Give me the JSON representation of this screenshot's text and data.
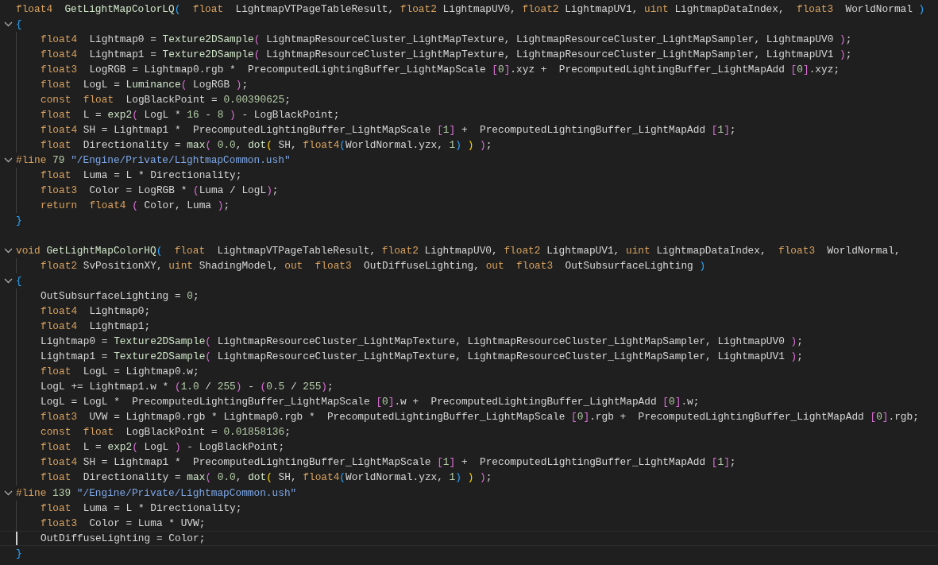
{
  "editor": {
    "lines": [
      {
        "fold": false,
        "indented": false,
        "current": false,
        "segments": [
          {
            "kind": "keyword",
            "text": "float4  "
          },
          {
            "kind": "function",
            "text": "GetLightMapColorLQ"
          },
          {
            "kind": "bracket1",
            "text": "(  "
          },
          {
            "kind": "keyword",
            "text": "float"
          },
          {
            "kind": "plain",
            "text": "  LightmapVTPageTableResult, "
          },
          {
            "kind": "keyword",
            "text": "float2"
          },
          {
            "kind": "plain",
            "text": " LightmapUV0, "
          },
          {
            "kind": "keyword",
            "text": "float2"
          },
          {
            "kind": "plain",
            "text": " LightmapUV1, "
          },
          {
            "kind": "keyword",
            "text": "uint"
          },
          {
            "kind": "plain",
            "text": " LightmapDataIndex,  "
          },
          {
            "kind": "keyword",
            "text": "float3"
          },
          {
            "kind": "plain",
            "text": "  WorldNormal "
          },
          {
            "kind": "bracket1",
            "text": ")"
          }
        ]
      },
      {
        "fold": true,
        "indented": false,
        "current": false,
        "segments": [
          {
            "kind": "bracket1",
            "text": "{"
          }
        ]
      },
      {
        "fold": false,
        "indented": true,
        "current": false,
        "segments": [
          {
            "kind": "keyword",
            "text": "float4"
          },
          {
            "kind": "plain",
            "text": "  Lightmap0 = "
          },
          {
            "kind": "function",
            "text": "Texture2DSample"
          },
          {
            "kind": "bracket2",
            "text": "("
          },
          {
            "kind": "plain",
            "text": " LightmapResourceCluster_LightMapTexture, LightmapResourceCluster_LightMapSampler, LightmapUV0 "
          },
          {
            "kind": "bracket2",
            "text": ")"
          },
          {
            "kind": "plain",
            "text": ";"
          }
        ]
      },
      {
        "fold": false,
        "indented": true,
        "current": false,
        "segments": [
          {
            "kind": "keyword",
            "text": "float4"
          },
          {
            "kind": "plain",
            "text": "  Lightmap1 = "
          },
          {
            "kind": "function",
            "text": "Texture2DSample"
          },
          {
            "kind": "bracket2",
            "text": "("
          },
          {
            "kind": "plain",
            "text": " LightmapResourceCluster_LightMapTexture, LightmapResourceCluster_LightMapSampler, LightmapUV1 "
          },
          {
            "kind": "bracket2",
            "text": ")"
          },
          {
            "kind": "plain",
            "text": ";"
          }
        ]
      },
      {
        "fold": false,
        "indented": true,
        "current": false,
        "segments": [
          {
            "kind": "keyword",
            "text": "float3"
          },
          {
            "kind": "plain",
            "text": "  LogRGB = Lightmap0.rgb *  PrecomputedLightingBuffer_LightMapScale "
          },
          {
            "kind": "bracket2",
            "text": "["
          },
          {
            "kind": "number",
            "text": "0"
          },
          {
            "kind": "bracket2",
            "text": "]"
          },
          {
            "kind": "plain",
            "text": ".xyz +  PrecomputedLightingBuffer_LightMapAdd "
          },
          {
            "kind": "bracket2",
            "text": "["
          },
          {
            "kind": "number",
            "text": "0"
          },
          {
            "kind": "bracket2",
            "text": "]"
          },
          {
            "kind": "plain",
            "text": ".xyz;"
          }
        ]
      },
      {
        "fold": false,
        "indented": true,
        "current": false,
        "segments": [
          {
            "kind": "keyword",
            "text": "float"
          },
          {
            "kind": "plain",
            "text": "  LogL = "
          },
          {
            "kind": "function",
            "text": "Luminance"
          },
          {
            "kind": "bracket2",
            "text": "("
          },
          {
            "kind": "plain",
            "text": " LogRGB "
          },
          {
            "kind": "bracket2",
            "text": ")"
          },
          {
            "kind": "plain",
            "text": ";"
          }
        ]
      },
      {
        "fold": false,
        "indented": true,
        "current": false,
        "segments": [
          {
            "kind": "keyword",
            "text": "const  "
          },
          {
            "kind": "keyword",
            "text": "float"
          },
          {
            "kind": "plain",
            "text": "  LogBlackPoint = "
          },
          {
            "kind": "number",
            "text": "0.00390625"
          },
          {
            "kind": "plain",
            "text": ";"
          }
        ]
      },
      {
        "fold": false,
        "indented": true,
        "current": false,
        "segments": [
          {
            "kind": "keyword",
            "text": "float"
          },
          {
            "kind": "plain",
            "text": "  L = "
          },
          {
            "kind": "function",
            "text": "exp2"
          },
          {
            "kind": "bracket2",
            "text": "("
          },
          {
            "kind": "plain",
            "text": " LogL * "
          },
          {
            "kind": "number",
            "text": "16"
          },
          {
            "kind": "plain",
            "text": " - "
          },
          {
            "kind": "number",
            "text": "8 "
          },
          {
            "kind": "bracket2",
            "text": ")"
          },
          {
            "kind": "plain",
            "text": " - LogBlackPoint;"
          }
        ]
      },
      {
        "fold": false,
        "indented": true,
        "current": false,
        "segments": [
          {
            "kind": "keyword",
            "text": "float4"
          },
          {
            "kind": "plain",
            "text": " SH = Lightmap1 *  PrecomputedLightingBuffer_LightMapScale "
          },
          {
            "kind": "bracket2",
            "text": "["
          },
          {
            "kind": "number",
            "text": "1"
          },
          {
            "kind": "bracket2",
            "text": "]"
          },
          {
            "kind": "plain",
            "text": " +  PrecomputedLightingBuffer_LightMapAdd "
          },
          {
            "kind": "bracket2",
            "text": "["
          },
          {
            "kind": "number",
            "text": "1"
          },
          {
            "kind": "bracket2",
            "text": "]"
          },
          {
            "kind": "plain",
            "text": ";"
          }
        ]
      },
      {
        "fold": false,
        "indented": true,
        "current": false,
        "segments": [
          {
            "kind": "keyword",
            "text": "float"
          },
          {
            "kind": "plain",
            "text": "  Directionality = "
          },
          {
            "kind": "function",
            "text": "max"
          },
          {
            "kind": "bracket2",
            "text": "( "
          },
          {
            "kind": "number",
            "text": "0.0"
          },
          {
            "kind": "plain",
            "text": ", "
          },
          {
            "kind": "function",
            "text": "dot"
          },
          {
            "kind": "bracket3",
            "text": "("
          },
          {
            "kind": "plain",
            "text": " SH, "
          },
          {
            "kind": "keyword",
            "text": "float4"
          },
          {
            "kind": "bracket1",
            "text": "("
          },
          {
            "kind": "plain",
            "text": "WorldNormal.yzx, "
          },
          {
            "kind": "number",
            "text": "1"
          },
          {
            "kind": "bracket1",
            "text": ") "
          },
          {
            "kind": "bracket3",
            "text": ") "
          },
          {
            "kind": "bracket2",
            "text": ")"
          },
          {
            "kind": "plain",
            "text": ";"
          }
        ]
      },
      {
        "fold": true,
        "indented": false,
        "current": false,
        "segments": [
          {
            "kind": "keyword",
            "text": "#line "
          },
          {
            "kind": "number",
            "text": "79 "
          },
          {
            "kind": "string",
            "text": "\"/Engine/Private/LightmapCommon.ush\""
          }
        ]
      },
      {
        "fold": false,
        "indented": true,
        "current": false,
        "segments": [
          {
            "kind": "keyword",
            "text": "float"
          },
          {
            "kind": "plain",
            "text": "  Luma = L * Directionality;"
          }
        ]
      },
      {
        "fold": false,
        "indented": true,
        "current": false,
        "segments": [
          {
            "kind": "keyword",
            "text": "float3"
          },
          {
            "kind": "plain",
            "text": "  Color = LogRGB * "
          },
          {
            "kind": "bracket2",
            "text": "("
          },
          {
            "kind": "plain",
            "text": "Luma / LogL"
          },
          {
            "kind": "bracket2",
            "text": ")"
          },
          {
            "kind": "plain",
            "text": ";"
          }
        ]
      },
      {
        "fold": false,
        "indented": true,
        "current": false,
        "segments": [
          {
            "kind": "keyword",
            "text": "return  "
          },
          {
            "kind": "keyword",
            "text": "float4 "
          },
          {
            "kind": "bracket2",
            "text": "("
          },
          {
            "kind": "plain",
            "text": " Color, Luma "
          },
          {
            "kind": "bracket2",
            "text": ")"
          },
          {
            "kind": "plain",
            "text": ";"
          }
        ]
      },
      {
        "fold": false,
        "indented": false,
        "current": false,
        "segments": [
          {
            "kind": "bracket1",
            "text": "}"
          }
        ]
      },
      {
        "fold": false,
        "indented": false,
        "current": false
      },
      {
        "fold": true,
        "indented": false,
        "current": false,
        "segments": [
          {
            "kind": "keyword",
            "text": "void "
          },
          {
            "kind": "function",
            "text": "GetLightMapColorHQ"
          },
          {
            "kind": "bracket1",
            "text": "(  "
          },
          {
            "kind": "keyword",
            "text": "float"
          },
          {
            "kind": "plain",
            "text": "  LightmapVTPageTableResult, "
          },
          {
            "kind": "keyword",
            "text": "float2"
          },
          {
            "kind": "plain",
            "text": " LightmapUV0, "
          },
          {
            "kind": "keyword",
            "text": "float2"
          },
          {
            "kind": "plain",
            "text": " LightmapUV1, "
          },
          {
            "kind": "keyword",
            "text": "uint"
          },
          {
            "kind": "plain",
            "text": " LightmapDataIndex,  "
          },
          {
            "kind": "keyword",
            "text": "float3"
          },
          {
            "kind": "plain",
            "text": "  WorldNormal,"
          }
        ]
      },
      {
        "fold": false,
        "indented": true,
        "current": false,
        "segments": [
          {
            "kind": "keyword",
            "text": "float2"
          },
          {
            "kind": "plain",
            "text": " SvPositionXY, "
          },
          {
            "kind": "keyword",
            "text": "uint"
          },
          {
            "kind": "plain",
            "text": " ShadingModel, "
          },
          {
            "kind": "keyword",
            "text": "out  "
          },
          {
            "kind": "keyword",
            "text": "float3"
          },
          {
            "kind": "plain",
            "text": "  OutDiffuseLighting, "
          },
          {
            "kind": "keyword",
            "text": "out  "
          },
          {
            "kind": "keyword",
            "text": "float3"
          },
          {
            "kind": "plain",
            "text": "  OutSubsurfaceLighting "
          },
          {
            "kind": "bracket1",
            "text": ")"
          }
        ]
      },
      {
        "fold": true,
        "indented": false,
        "current": false,
        "segments": [
          {
            "kind": "bracket1",
            "text": "{"
          }
        ]
      },
      {
        "fold": false,
        "indented": true,
        "current": false,
        "segments": [
          {
            "kind": "plain",
            "text": "OutSubsurfaceLighting = "
          },
          {
            "kind": "number",
            "text": "0"
          },
          {
            "kind": "plain",
            "text": ";"
          }
        ]
      },
      {
        "fold": false,
        "indented": true,
        "current": false,
        "segments": [
          {
            "kind": "keyword",
            "text": "float4"
          },
          {
            "kind": "plain",
            "text": "  Lightmap0;"
          }
        ]
      },
      {
        "fold": false,
        "indented": true,
        "current": false,
        "segments": [
          {
            "kind": "keyword",
            "text": "float4"
          },
          {
            "kind": "plain",
            "text": "  Lightmap1;"
          }
        ]
      },
      {
        "fold": false,
        "indented": true,
        "current": false,
        "segments": [
          {
            "kind": "plain",
            "text": "Lightmap0 = "
          },
          {
            "kind": "function",
            "text": "Texture2DSample"
          },
          {
            "kind": "bracket2",
            "text": "("
          },
          {
            "kind": "plain",
            "text": " LightmapResourceCluster_LightMapTexture, LightmapResourceCluster_LightMapSampler, LightmapUV0 "
          },
          {
            "kind": "bracket2",
            "text": ")"
          },
          {
            "kind": "plain",
            "text": ";"
          }
        ]
      },
      {
        "fold": false,
        "indented": true,
        "current": false,
        "segments": [
          {
            "kind": "plain",
            "text": "Lightmap1 = "
          },
          {
            "kind": "function",
            "text": "Texture2DSample"
          },
          {
            "kind": "bracket2",
            "text": "("
          },
          {
            "kind": "plain",
            "text": " LightmapResourceCluster_LightMapTexture, LightmapResourceCluster_LightMapSampler, LightmapUV1 "
          },
          {
            "kind": "bracket2",
            "text": ")"
          },
          {
            "kind": "plain",
            "text": ";"
          }
        ]
      },
      {
        "fold": false,
        "indented": true,
        "current": false,
        "segments": [
          {
            "kind": "keyword",
            "text": "float"
          },
          {
            "kind": "plain",
            "text": "  LogL = Lightmap0.w;"
          }
        ]
      },
      {
        "fold": false,
        "indented": true,
        "current": false,
        "segments": [
          {
            "kind": "plain",
            "text": "LogL += Lightmap1.w * "
          },
          {
            "kind": "bracket2",
            "text": "("
          },
          {
            "kind": "number",
            "text": "1.0"
          },
          {
            "kind": "plain",
            "text": " / "
          },
          {
            "kind": "number",
            "text": "255"
          },
          {
            "kind": "bracket2",
            "text": ")"
          },
          {
            "kind": "plain",
            "text": " - "
          },
          {
            "kind": "bracket2",
            "text": "("
          },
          {
            "kind": "number",
            "text": "0.5"
          },
          {
            "kind": "plain",
            "text": " / "
          },
          {
            "kind": "number",
            "text": "255"
          },
          {
            "kind": "bracket2",
            "text": ")"
          },
          {
            "kind": "plain",
            "text": ";"
          }
        ]
      },
      {
        "fold": false,
        "indented": true,
        "current": false,
        "segments": [
          {
            "kind": "plain",
            "text": "LogL = LogL *  PrecomputedLightingBuffer_LightMapScale "
          },
          {
            "kind": "bracket2",
            "text": "["
          },
          {
            "kind": "number",
            "text": "0"
          },
          {
            "kind": "bracket2",
            "text": "]"
          },
          {
            "kind": "plain",
            "text": ".w +  PrecomputedLightingBuffer_LightMapAdd "
          },
          {
            "kind": "bracket2",
            "text": "["
          },
          {
            "kind": "number",
            "text": "0"
          },
          {
            "kind": "bracket2",
            "text": "]"
          },
          {
            "kind": "plain",
            "text": ".w;"
          }
        ]
      },
      {
        "fold": false,
        "indented": true,
        "current": false,
        "segments": [
          {
            "kind": "keyword",
            "text": "float3"
          },
          {
            "kind": "plain",
            "text": "  UVW = Lightmap0.rgb * Lightmap0.rgb *  PrecomputedLightingBuffer_LightMapScale "
          },
          {
            "kind": "bracket2",
            "text": "["
          },
          {
            "kind": "number",
            "text": "0"
          },
          {
            "kind": "bracket2",
            "text": "]"
          },
          {
            "kind": "plain",
            "text": ".rgb +  PrecomputedLightingBuffer_LightMapAdd "
          },
          {
            "kind": "bracket2",
            "text": "["
          },
          {
            "kind": "number",
            "text": "0"
          },
          {
            "kind": "bracket2",
            "text": "]"
          },
          {
            "kind": "plain",
            "text": ".rgb;"
          }
        ]
      },
      {
        "fold": false,
        "indented": true,
        "current": false,
        "segments": [
          {
            "kind": "keyword",
            "text": "const  "
          },
          {
            "kind": "keyword",
            "text": "float"
          },
          {
            "kind": "plain",
            "text": "  LogBlackPoint = "
          },
          {
            "kind": "number",
            "text": "0.01858136"
          },
          {
            "kind": "plain",
            "text": ";"
          }
        ]
      },
      {
        "fold": false,
        "indented": true,
        "current": false,
        "segments": [
          {
            "kind": "keyword",
            "text": "float"
          },
          {
            "kind": "plain",
            "text": "  L = "
          },
          {
            "kind": "function",
            "text": "exp2"
          },
          {
            "kind": "bracket2",
            "text": "("
          },
          {
            "kind": "plain",
            "text": " LogL "
          },
          {
            "kind": "bracket2",
            "text": ")"
          },
          {
            "kind": "plain",
            "text": " - LogBlackPoint;"
          }
        ]
      },
      {
        "fold": false,
        "indented": true,
        "current": false,
        "segments": [
          {
            "kind": "keyword",
            "text": "float4"
          },
          {
            "kind": "plain",
            "text": " SH = Lightmap1 *  PrecomputedLightingBuffer_LightMapScale "
          },
          {
            "kind": "bracket2",
            "text": "["
          },
          {
            "kind": "number",
            "text": "1"
          },
          {
            "kind": "bracket2",
            "text": "]"
          },
          {
            "kind": "plain",
            "text": " +  PrecomputedLightingBuffer_LightMapAdd "
          },
          {
            "kind": "bracket2",
            "text": "["
          },
          {
            "kind": "number",
            "text": "1"
          },
          {
            "kind": "bracket2",
            "text": "]"
          },
          {
            "kind": "plain",
            "text": ";"
          }
        ]
      },
      {
        "fold": false,
        "indented": true,
        "current": false,
        "segments": [
          {
            "kind": "keyword",
            "text": "float"
          },
          {
            "kind": "plain",
            "text": "  Directionality = "
          },
          {
            "kind": "function",
            "text": "max"
          },
          {
            "kind": "bracket2",
            "text": "( "
          },
          {
            "kind": "number",
            "text": "0.0"
          },
          {
            "kind": "plain",
            "text": ", "
          },
          {
            "kind": "function",
            "text": "dot"
          },
          {
            "kind": "bracket3",
            "text": "("
          },
          {
            "kind": "plain",
            "text": " SH, "
          },
          {
            "kind": "keyword",
            "text": "float4"
          },
          {
            "kind": "bracket1",
            "text": "("
          },
          {
            "kind": "plain",
            "text": "WorldNormal.yzx, "
          },
          {
            "kind": "number",
            "text": "1"
          },
          {
            "kind": "bracket1",
            "text": ") "
          },
          {
            "kind": "bracket3",
            "text": ") "
          },
          {
            "kind": "bracket2",
            "text": ")"
          },
          {
            "kind": "plain",
            "text": ";"
          }
        ]
      },
      {
        "fold": true,
        "indented": false,
        "current": false,
        "segments": [
          {
            "kind": "keyword",
            "text": "#line "
          },
          {
            "kind": "number",
            "text": "139 "
          },
          {
            "kind": "string",
            "text": "\"/Engine/Private/LightmapCommon.ush\""
          }
        ]
      },
      {
        "fold": false,
        "indented": true,
        "current": false,
        "segments": [
          {
            "kind": "keyword",
            "text": "float"
          },
          {
            "kind": "plain",
            "text": "  Luma = L * Directionality;"
          }
        ]
      },
      {
        "fold": false,
        "indented": true,
        "current": false,
        "segments": [
          {
            "kind": "keyword",
            "text": "float3"
          },
          {
            "kind": "plain",
            "text": "  Color = Luma * UVW;"
          }
        ]
      },
      {
        "fold": false,
        "indented": true,
        "current": true,
        "segments": [
          {
            "kind": "plain",
            "text": "OutDiffuseLighting = Color;"
          }
        ]
      },
      {
        "fold": false,
        "indented": false,
        "current": false,
        "segments": [
          {
            "kind": "bracket1",
            "text": "}"
          }
        ]
      }
    ]
  }
}
